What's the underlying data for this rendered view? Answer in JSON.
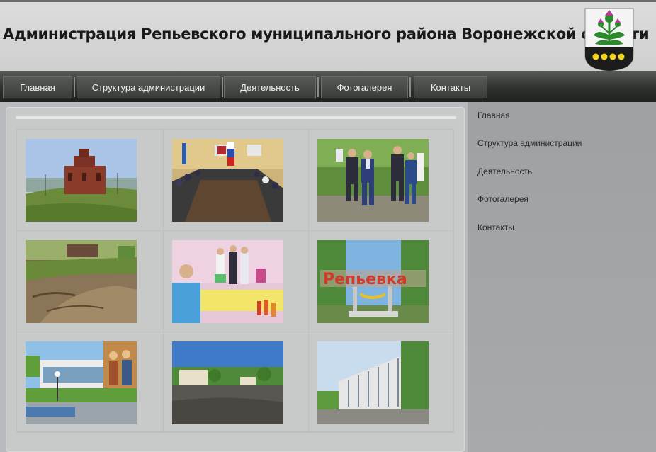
{
  "header": {
    "title": "Администрация Репьевского муниципального района Воронежской области",
    "coat_of_arms_icon": "coat-of-arms-thistle"
  },
  "nav": {
    "items": [
      {
        "label": "Главная"
      },
      {
        "label": "Структура администрации"
      },
      {
        "label": "Деятельность"
      },
      {
        "label": "Фотогалерея"
      },
      {
        "label": "Контакты"
      }
    ]
  },
  "sidebar": {
    "items": [
      {
        "label": "Главная"
      },
      {
        "label": "Структура администрации"
      },
      {
        "label": "Деятельность"
      },
      {
        "label": "Фотогалерея"
      },
      {
        "label": "Контакты"
      }
    ]
  },
  "gallery": {
    "photos": [
      {
        "subject": "church-on-hill"
      },
      {
        "subject": "meeting-room"
      },
      {
        "subject": "officials-walking"
      },
      {
        "subject": "ravine-erosion"
      },
      {
        "subject": "kindergarten"
      },
      {
        "subject": "repyevka-sign"
      },
      {
        "subject": "building-with-mural"
      },
      {
        "subject": "town-square"
      },
      {
        "subject": "administration-building"
      }
    ],
    "sign_text": "Репьевка"
  },
  "colors": {
    "nav_dark": "#2f312f",
    "sidebar_bg": "#a3a6a9",
    "header_bg": "#d6d6d6"
  }
}
